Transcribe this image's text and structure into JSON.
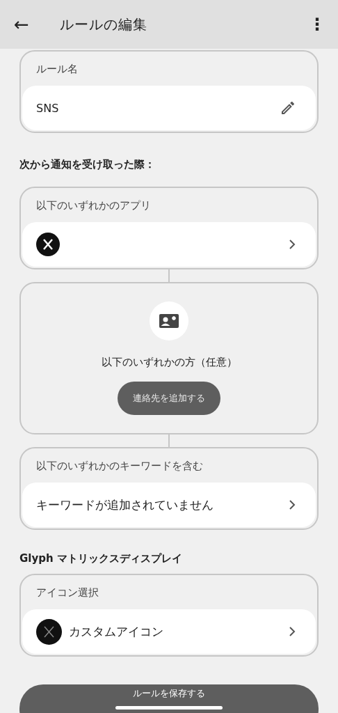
{
  "header": {
    "back": "←",
    "title": "ルールの編集",
    "menu": "⋮"
  },
  "rule_name": {
    "label": "ルール名",
    "value": "SNS"
  },
  "trigger_heading": "次から通知を受け取った際：",
  "apps": {
    "label": "以下のいずれかのアプリ"
  },
  "contacts": {
    "label": "以下のいずれかの方（任意）",
    "button": "連絡先を追加する"
  },
  "keywords": {
    "label": "以下のいずれかのキーワードを含む",
    "value": "キーワードが追加されていません"
  },
  "glyph_heading": "Glyph マトリックスディスプレイ",
  "icon_select": {
    "label": "アイコン選択",
    "value": "カスタムアイコン"
  },
  "save_button": "ルールを保存する"
}
